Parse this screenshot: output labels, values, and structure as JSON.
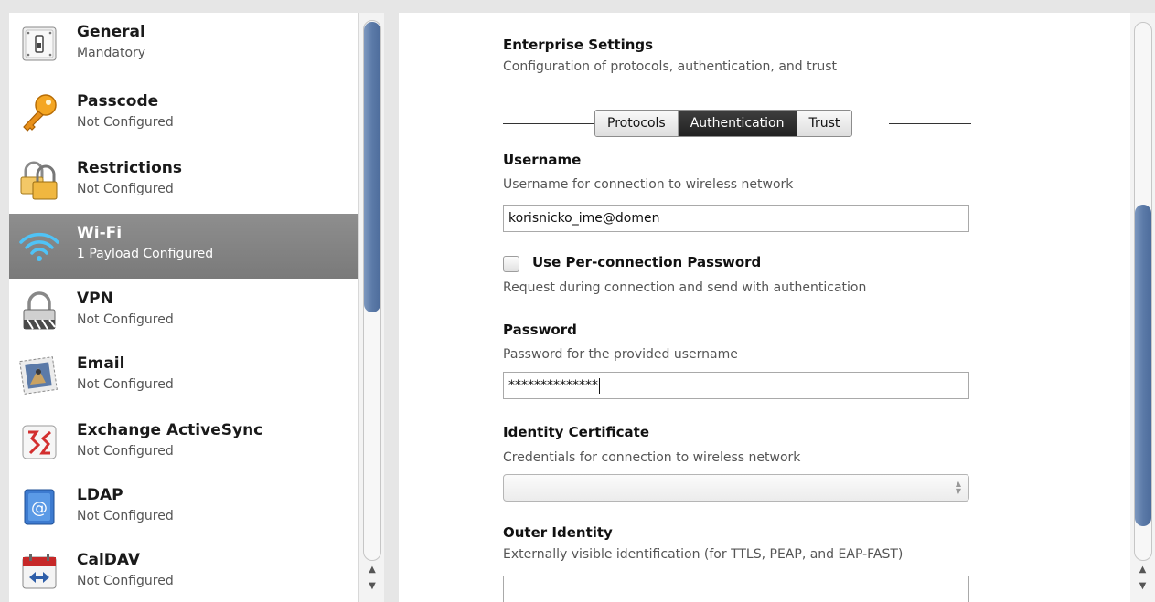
{
  "sidebar": {
    "items": [
      {
        "title": "General",
        "subtitle": "Mandatory",
        "icon": "general-icon"
      },
      {
        "title": "Passcode",
        "subtitle": "Not Configured",
        "icon": "key-icon"
      },
      {
        "title": "Restrictions",
        "subtitle": "Not Configured",
        "icon": "padlocks-icon"
      },
      {
        "title": "Wi-Fi",
        "subtitle": "1 Payload Configured",
        "icon": "wifi-icon",
        "selected": true
      },
      {
        "title": "VPN",
        "subtitle": "Not Configured",
        "icon": "vpn-lock-icon"
      },
      {
        "title": "Email",
        "subtitle": "Not Configured",
        "icon": "email-stamp-icon"
      },
      {
        "title": "Exchange ActiveSync",
        "subtitle": "Not Configured",
        "icon": "exchange-icon"
      },
      {
        "title": "LDAP",
        "subtitle": "Not Configured",
        "icon": "ldap-at-icon"
      },
      {
        "title": "CalDAV",
        "subtitle": "Not Configured",
        "icon": "calendar-icon"
      }
    ]
  },
  "main": {
    "section_title": "Enterprise Settings",
    "section_desc": "Configuration of protocols, authentication, and trust",
    "tabs": [
      {
        "label": "Protocols",
        "active": false
      },
      {
        "label": "Authentication",
        "active": true
      },
      {
        "label": "Trust",
        "active": false
      }
    ],
    "username": {
      "label": "Username",
      "desc": "Username for connection to wireless network",
      "value": "korisnicko_ime@domen"
    },
    "per_connection": {
      "label": "Use Per-connection Password",
      "desc": "Request during connection and send with authentication",
      "checked": false
    },
    "password": {
      "label": "Password",
      "desc": "Password for the provided username",
      "value": "**************"
    },
    "identity_cert": {
      "label": "Identity Certificate",
      "desc": "Credentials for connection to wireless network",
      "value": ""
    },
    "outer_identity": {
      "label": "Outer Identity",
      "desc": "Externally visible identification (for TTLS, PEAP, and EAP-FAST)",
      "value": ""
    }
  },
  "colors": {
    "selected_row": "#858585",
    "scroll_thumb": "#5b7aa8",
    "active_tab": "#2e2e2e"
  }
}
